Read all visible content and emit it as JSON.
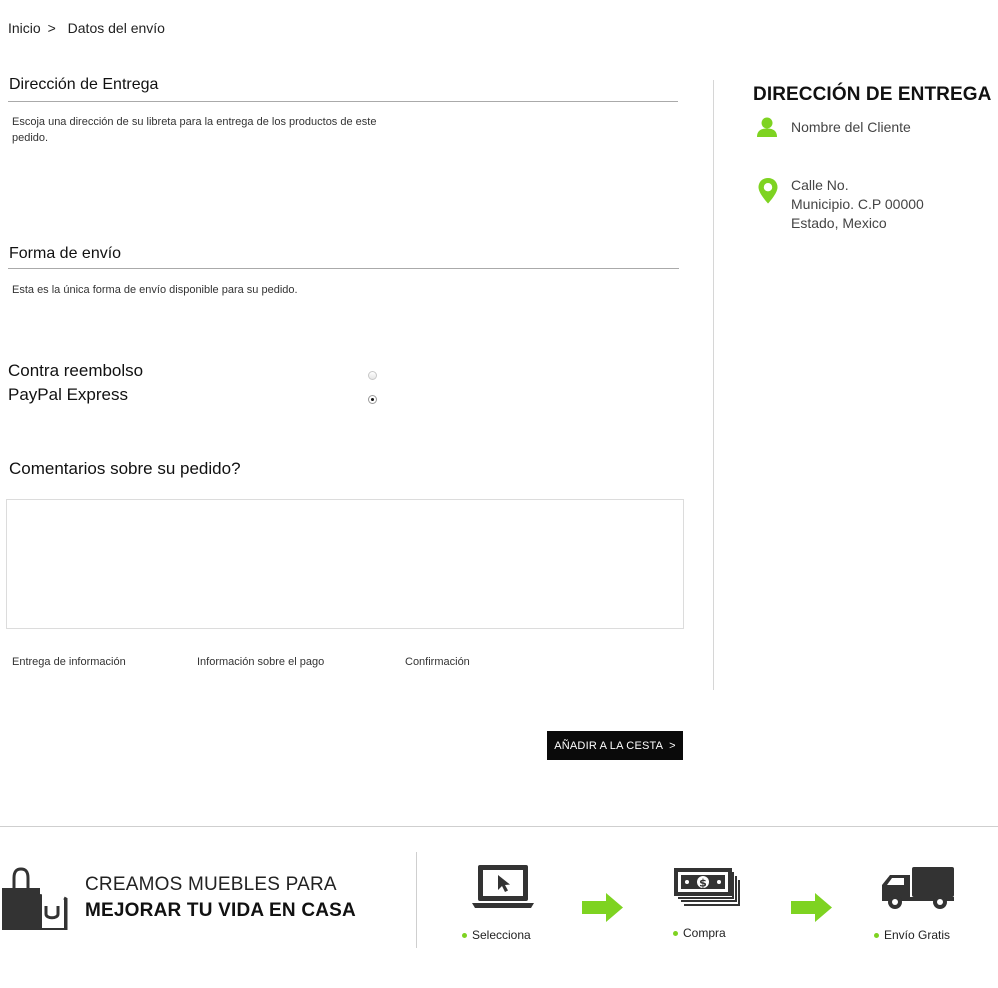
{
  "breadcrumb": {
    "home": "Inicio",
    "separator": ">",
    "current": "Datos del envío"
  },
  "delivery_address": {
    "title": "Dirección de Entrega",
    "description": "Escoja una dirección de su libreta para la entrega de los productos de este pedido."
  },
  "shipping": {
    "title": "Forma de envío",
    "description": "Esta es la única forma de envío disponible para su pedido.",
    "options": [
      {
        "label": "Contra reembolso",
        "selected": false
      },
      {
        "label": "PayPal Express",
        "selected": true
      }
    ]
  },
  "comments": {
    "title": "Comentarios sobre su pedido?",
    "value": ""
  },
  "steps": [
    "Entrega de información",
    "Información sobre el pago",
    "Confirmación"
  ],
  "cart_button": {
    "label": "AÑADIR A LA CESTA",
    "arrow": ">"
  },
  "sidebar": {
    "title": "DIRECCIÓN DE ENTREGA",
    "customer_name": "Nombre del Cliente",
    "address_line1": "Calle No.",
    "address_line2": "Municipio. C.P 00000",
    "address_line3": "Estado, Mexico"
  },
  "footer": {
    "tagline_line1": "CREAMOS MUEBLES PARA",
    "tagline_line2": "MEJORAR TU VIDA EN CASA",
    "features": [
      {
        "label": "Selecciona",
        "icon": "laptop-cursor-icon"
      },
      {
        "label": "Compra",
        "icon": "money-stack-icon"
      },
      {
        "label": "Envío Gratis",
        "icon": "delivery-truck-icon"
      }
    ]
  },
  "colors": {
    "accent": "#7ed321",
    "button_bg": "#0a0a0a",
    "text": "#222222",
    "icon_dark": "#333333"
  }
}
